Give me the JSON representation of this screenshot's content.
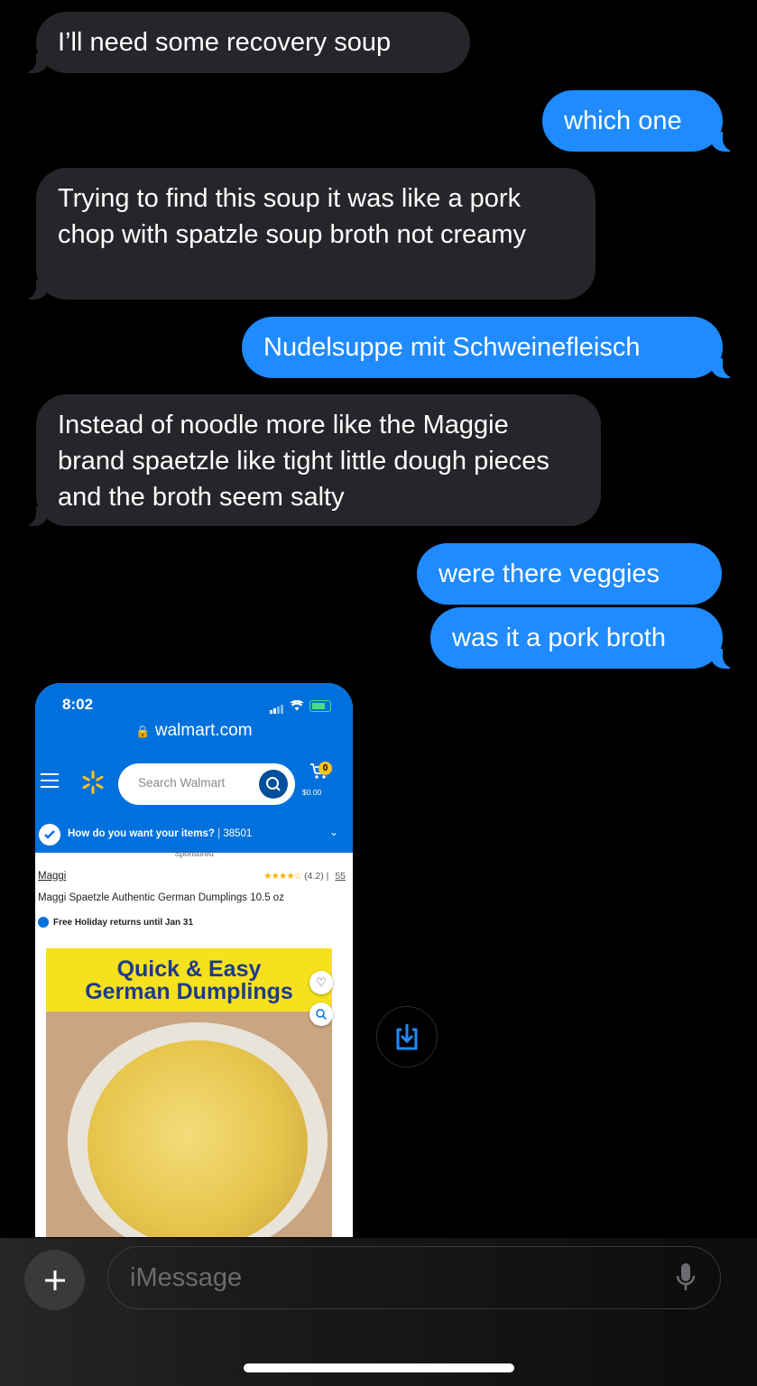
{
  "messages": [
    {
      "dir": "in",
      "text": "I’ll need some recovery soup"
    },
    {
      "dir": "out",
      "text": "which one"
    },
    {
      "dir": "in",
      "text": "Trying to find this soup it was like a pork chop with spatzle soup broth not creamy"
    },
    {
      "dir": "out",
      "text": "Nudelsuppe mit Schweinefleisch"
    },
    {
      "dir": "in",
      "text": "Instead of noodle more like the Maggie brand spaetzle like tight little dough pieces and the broth seem salty"
    },
    {
      "dir": "out",
      "text": "were there veggies"
    },
    {
      "dir": "out",
      "text": "was it a pork broth"
    }
  ],
  "screenshot": {
    "time": "8:02",
    "url": "walmart.com",
    "search_placeholder": "Search Walmart",
    "cart_count": "0",
    "cart_total": "$0.00",
    "delivery_prompt": "How do you want your items?",
    "zip": "38501",
    "sponsored": "Sponsored",
    "brand": "Maggi",
    "rating_text": "(4.2)",
    "review_count": "55",
    "product_title": "Maggi Spaetzle Authentic German Dumplings 10.5 oz",
    "returns_text": "Free Holiday returns until Jan 31",
    "banner_line1": "Quick & Easy",
    "banner_line2": "German Dumplings"
  },
  "composer": {
    "placeholder": "iMessage"
  },
  "icons": [
    "plus-icon",
    "microphone-icon",
    "save-download-icon",
    "heart-icon",
    "zoom-icon",
    "search-icon",
    "cart-icon",
    "menu-icon",
    "spark-logo-icon"
  ],
  "colors": {
    "outgoing": "#1f8bff",
    "incoming": "#26252a",
    "walmart_blue": "#0071dc",
    "walmart_yellow": "#ffc220"
  }
}
